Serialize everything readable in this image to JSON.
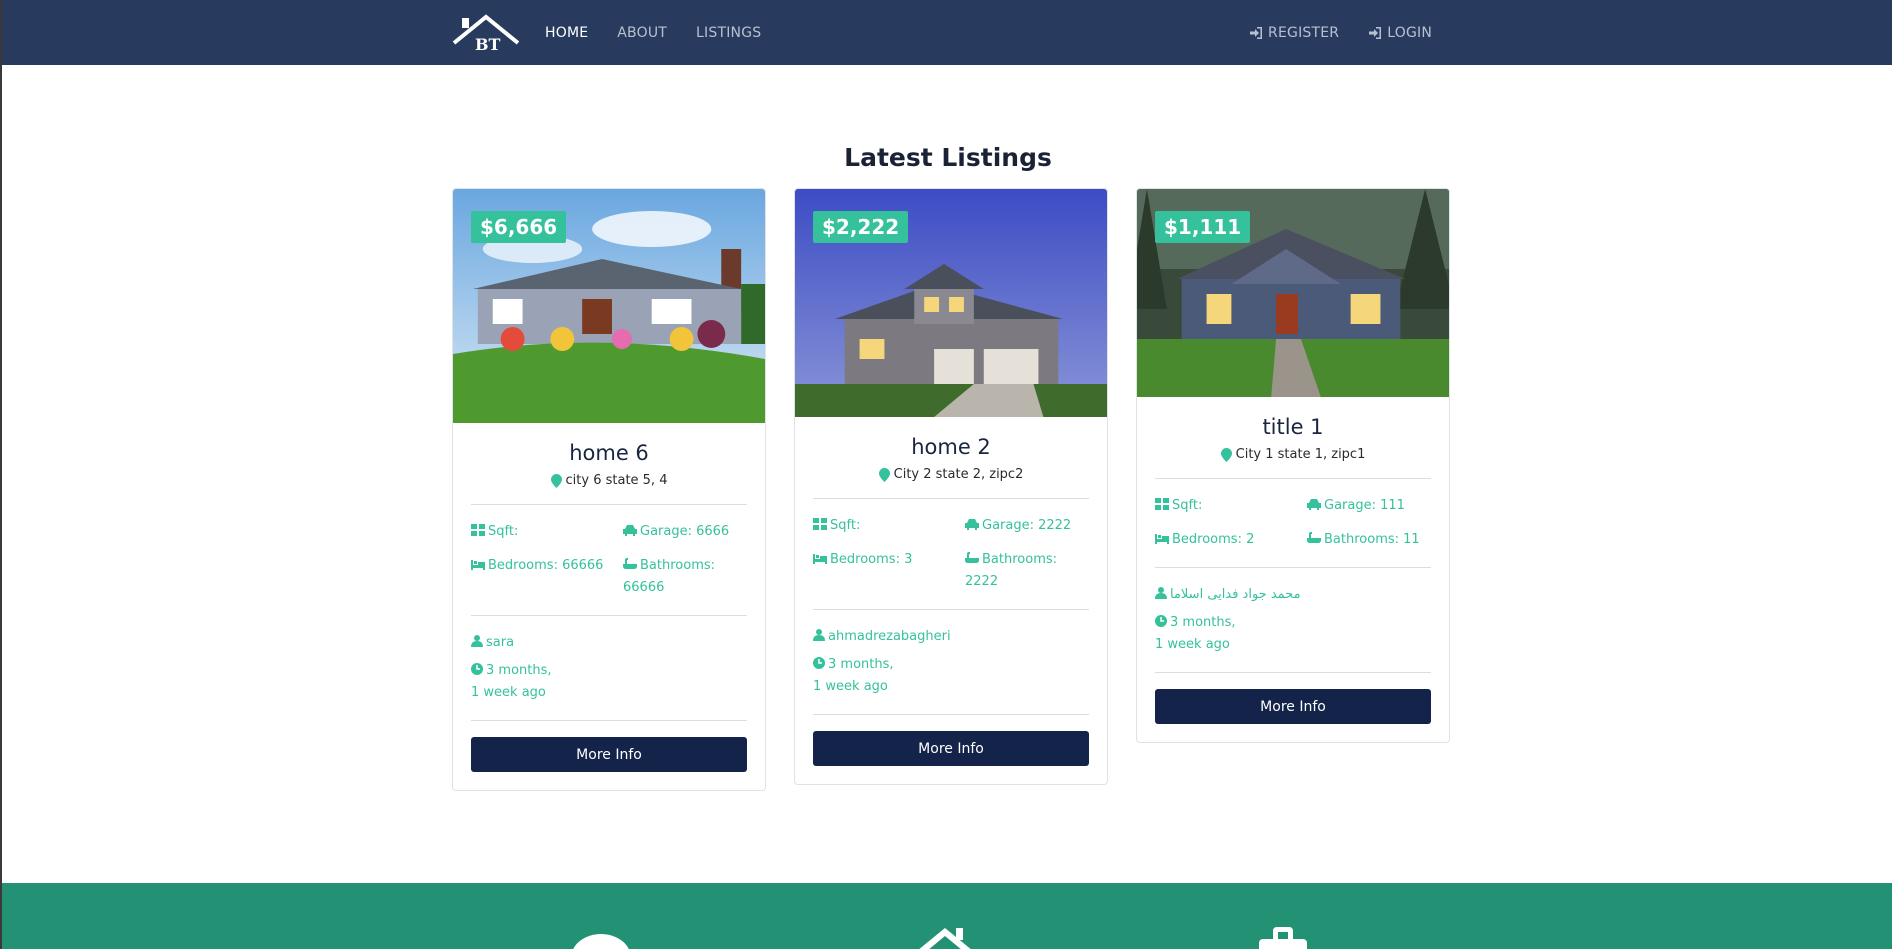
{
  "nav": {
    "logo_text": "BT",
    "links": [
      "HOME",
      "ABOUT",
      "LISTINGS"
    ],
    "register": "REGISTER",
    "login": "LOGIN"
  },
  "section": {
    "title": "Latest Listings"
  },
  "colors": {
    "navbar": "#283b5e",
    "accent": "#35c19c",
    "button": "#13234a",
    "band": "#239274"
  },
  "listings": [
    {
      "price": "$6,666",
      "title": "home 6",
      "location": "city 6 state 5, 4",
      "sqft": "Sqft:",
      "garage": "Garage: 6666",
      "bedrooms": "Bedrooms: 66666",
      "bathrooms": "Bathrooms: 66666",
      "realtor": "sara",
      "time": "3 months, 1 week ago",
      "button": "More Info"
    },
    {
      "price": "$2,222",
      "title": "home 2",
      "location": "City 2 state 2, zipc2",
      "sqft": "Sqft:",
      "garage": "Garage: 2222",
      "bedrooms": "Bedrooms: 3",
      "bathrooms": "Bathrooms: 2222",
      "realtor": "ahmadrezabagheri",
      "time": "3 months, 1 week ago",
      "button": "More Info"
    },
    {
      "price": "$1,111",
      "title": "title 1",
      "location": "City 1 state 1, zipc1",
      "sqft": "Sqft:",
      "garage": "Garage: 111",
      "bedrooms": "Bedrooms: 2",
      "bathrooms": "Bathrooms: 11",
      "realtor": "محمد جواد فدایی اسلاما",
      "time": "3 months, 1 week ago",
      "button": "More Info"
    }
  ],
  "band_icons": [
    "comment-icon",
    "home-icon",
    "suitcase-icon"
  ]
}
